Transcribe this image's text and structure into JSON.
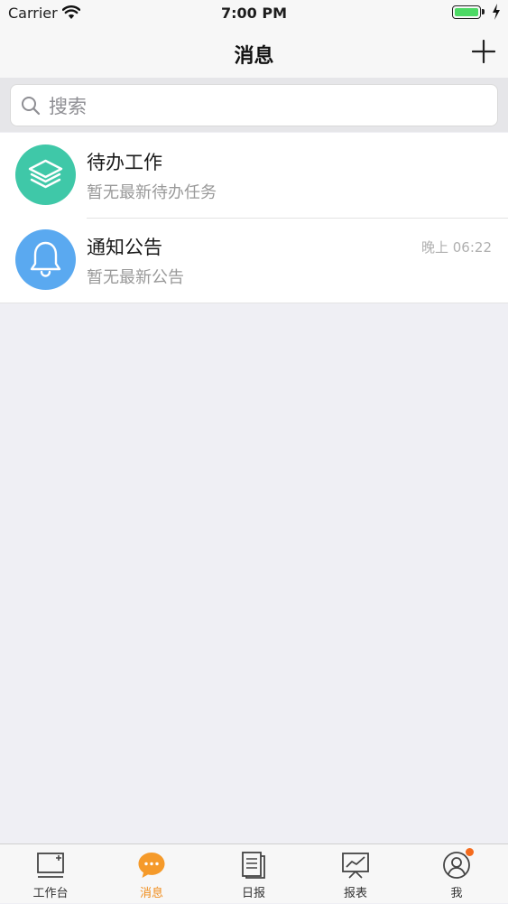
{
  "status_bar": {
    "carrier": "Carrier",
    "time": "7:00 PM"
  },
  "nav": {
    "title": "消息"
  },
  "search": {
    "placeholder": "搜索"
  },
  "messages": [
    {
      "name": "待办工作",
      "subtitle": "暂无最新待办任务",
      "time": "",
      "icon": "layers-icon",
      "color": "#3fc8a8"
    },
    {
      "name": "通知公告",
      "subtitle": "暂无最新公告",
      "time": "晚上 06:22",
      "icon": "bell-icon",
      "color": "#5aa9f0"
    }
  ],
  "tabs": [
    {
      "label": "工作台",
      "icon": "workbench-icon"
    },
    {
      "label": "消息",
      "icon": "chat-bubble-icon",
      "active": true
    },
    {
      "label": "日报",
      "icon": "document-icon"
    },
    {
      "label": "报表",
      "icon": "chart-icon"
    },
    {
      "label": "我",
      "icon": "user-icon",
      "badge": true
    }
  ],
  "colors": {
    "accent": "#f08c1a",
    "badge": "#f56b1d",
    "battery": "#4cd964"
  }
}
